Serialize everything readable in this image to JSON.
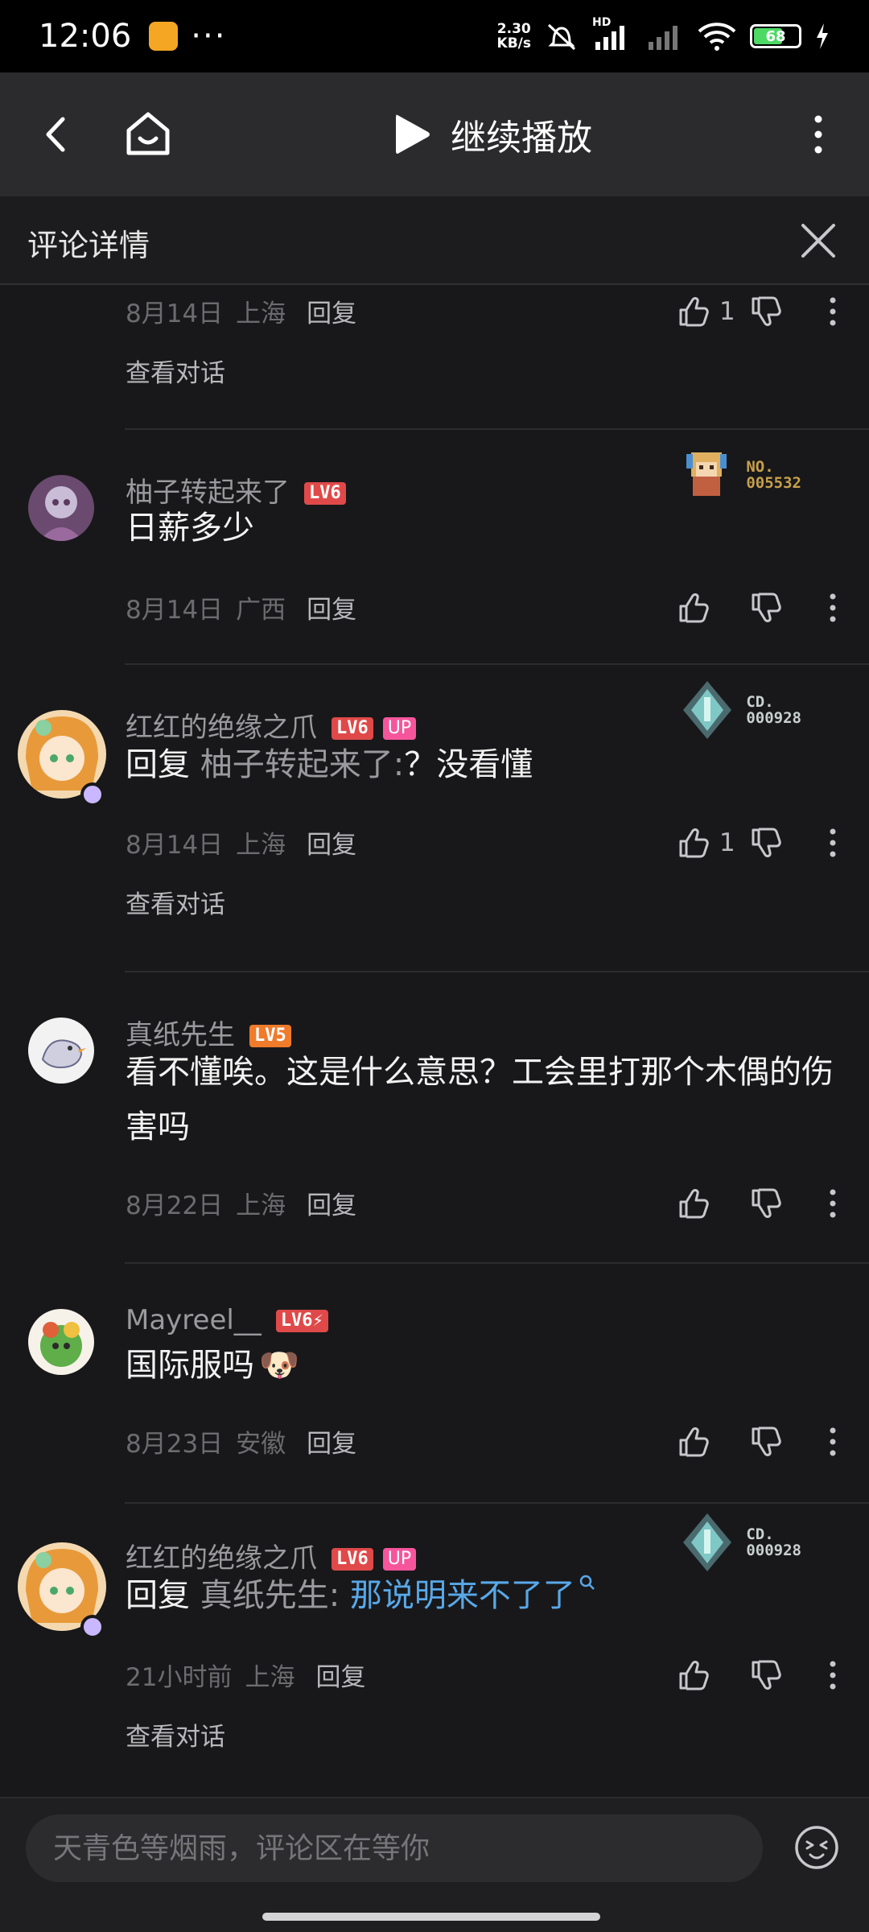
{
  "status_bar": {
    "time": "12:06",
    "dots": "···",
    "net_speed_value": "2.30",
    "net_speed_unit": "KB/s",
    "hd_label": "HD",
    "battery": "68",
    "battery_level": 0.68,
    "icons": [
      "app-notification-icon",
      "mute-icon",
      "signal-icon",
      "wifi-icon",
      "battery-icon",
      "charging-icon"
    ]
  },
  "nav": {
    "continue_label": "继续播放",
    "icons": [
      "back-icon",
      "home-icon",
      "play-icon",
      "more-icon"
    ]
  },
  "detail": {
    "title": "评论详情"
  },
  "comments": [
    {
      "date": "8月14日",
      "location": "上海",
      "reply_label": "回复",
      "likes": "1",
      "view_conversation": "查看对话"
    },
    {
      "username": "柚子转起来了",
      "level": "LV6",
      "text": "日薪多少",
      "date": "8月14日",
      "location": "广西",
      "reply_label": "回复",
      "fan_no_label": "NO.",
      "fan_no": "005532"
    },
    {
      "username": "红红的绝缘之爪",
      "level": "LV6",
      "up_tag": "UP",
      "reply_prefix": "回复",
      "reply_target": "柚子转起来了:",
      "text": "？没看懂",
      "date": "8月14日",
      "location": "上海",
      "reply_label": "回复",
      "likes": "1",
      "view_conversation": "查看对话",
      "fan_no_label": "CD.",
      "fan_no": "000928"
    },
    {
      "username": "真纸先生",
      "level": "LV5",
      "text": "看不懂唉。这是什么意思？工会里打那个木偶的伤害吗",
      "date": "8月22日",
      "location": "上海",
      "reply_label": "回复"
    },
    {
      "username": "Mayreel__",
      "level": "LV6⚡",
      "text": "国际服吗",
      "emoji": "🐶",
      "date": "8月23日",
      "location": "安徽",
      "reply_label": "回复"
    },
    {
      "username": "红红的绝缘之爪",
      "level": "LV6",
      "up_tag": "UP",
      "reply_prefix": "回复",
      "reply_target": "真纸先生:",
      "text": "那说明来不了了",
      "date": "21小时前",
      "location": "上海",
      "reply_label": "回复",
      "view_conversation": "查看对话",
      "fan_no_label": "CD.",
      "fan_no": "000928"
    }
  ],
  "input": {
    "placeholder": "天青色等烟雨，评论区在等你"
  },
  "colors": {
    "background": "#18181a",
    "nav_bg": "#2b2b2d",
    "level_red": "#e04949",
    "level_orange": "#ef7b2b",
    "up_pink": "#f6559c",
    "link_blue": "#58a8e8",
    "fan_gold": "#c8a04a"
  }
}
